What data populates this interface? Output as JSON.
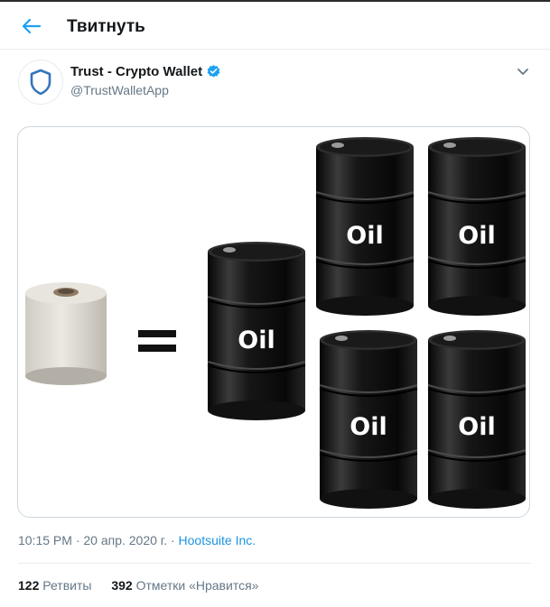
{
  "header": {
    "title": "Твитнуть"
  },
  "tweet": {
    "author_name": "Trust - Crypto Wallet",
    "author_handle": "@TrustWalletApp",
    "image": {
      "barrel_labels": [
        "Oil",
        "Oil",
        "Oil",
        "Oil",
        "Oil"
      ]
    },
    "timestamp": "10:15 PM · 20 апр. 2020 г. · ",
    "source": "Hootsuite Inc.",
    "retweets_count": "122",
    "retweets_label": "Ретвиты",
    "likes_count": "392",
    "likes_label": "Отметки «Нравится»"
  },
  "colors": {
    "accent": "#1da1f2",
    "verified": "#1da1f2",
    "shield": "#3375bb"
  },
  "icons": {
    "back": "arrow-left-icon",
    "verified": "verified-badge-icon",
    "more": "chevron-down-icon",
    "avatar": "shield-icon"
  }
}
